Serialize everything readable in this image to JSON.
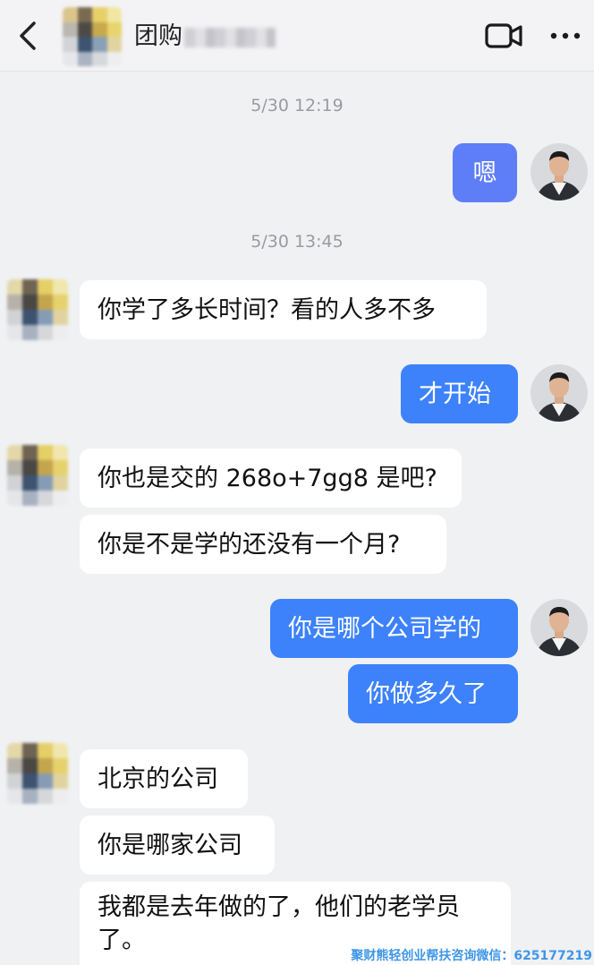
{
  "header": {
    "back_icon": "chevron-left-icon",
    "title": "团购",
    "video_icon": "video-call-icon",
    "more_icon": "more-horizontal-icon"
  },
  "timestamps": [
    "5/30 12:19",
    "5/30 13:45"
  ],
  "messages": [
    {
      "side": "out",
      "text": "嗯"
    },
    {
      "side": "in",
      "text": "你学了多长时间？看的人多不多"
    },
    {
      "side": "out",
      "text": "才开始"
    },
    {
      "side": "in",
      "text": "你也是交的 268o+7gg8 是吧?"
    },
    {
      "side": "in",
      "text": "你是不是学的还没有一个月?"
    },
    {
      "side": "out",
      "text": "你是哪个公司学的"
    },
    {
      "side": "out",
      "text": "你做多久了"
    },
    {
      "side": "in",
      "text": "北京的公司"
    },
    {
      "side": "in",
      "text": "你是哪家公司"
    },
    {
      "side": "in",
      "text": "我都是去年做的了，他们的老学员了。"
    }
  ],
  "watermark": "聚财熊轻创业帮扶咨询微信：625177219",
  "colors": {
    "bubble_out": "#3d82fa",
    "bubble_out_first": "#5e7ef8",
    "bubble_in": "#ffffff",
    "background": "#f0f1f3",
    "watermark": "#3f96e6"
  }
}
